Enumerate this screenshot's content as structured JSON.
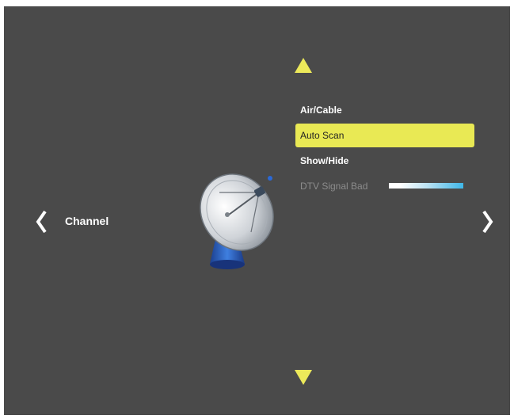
{
  "colors": {
    "background": "#4a4a4a",
    "accent": "#ece95a",
    "selected_row": "#e9e954",
    "text": "#ffffff",
    "disabled_text": "#8c8c8c",
    "signal_bar_end": "#3fb7e8"
  },
  "nav": {
    "prev_icon": "chevron-left-icon",
    "next_icon": "chevron-right-icon",
    "up_icon": "triangle-up-icon",
    "down_icon": "triangle-down-icon"
  },
  "category": {
    "label": "Channel",
    "icon": "satellite-dish-icon"
  },
  "menu": {
    "items": [
      {
        "label": "Air/Cable",
        "state": "normal"
      },
      {
        "label": "Auto Scan",
        "state": "selected"
      },
      {
        "label": "Show/Hide",
        "state": "normal"
      },
      {
        "label": "DTV Signal Bad",
        "state": "disabled"
      }
    ]
  }
}
